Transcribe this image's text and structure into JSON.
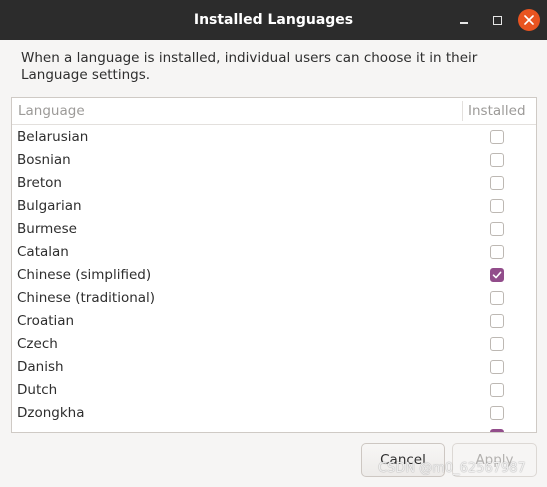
{
  "window": {
    "title": "Installed Languages"
  },
  "info_text": "When a language is installed, individual users can choose it in their Language settings.",
  "table": {
    "columns": [
      "Language",
      "Installed"
    ],
    "rows": [
      {
        "language": "Belarusian",
        "installed": false
      },
      {
        "language": "Bosnian",
        "installed": false
      },
      {
        "language": "Breton",
        "installed": false
      },
      {
        "language": "Bulgarian",
        "installed": false
      },
      {
        "language": "Burmese",
        "installed": false
      },
      {
        "language": "Catalan",
        "installed": false
      },
      {
        "language": "Chinese (simplified)",
        "installed": true
      },
      {
        "language": "Chinese (traditional)",
        "installed": false
      },
      {
        "language": "Croatian",
        "installed": false
      },
      {
        "language": "Czech",
        "installed": false
      },
      {
        "language": "Danish",
        "installed": false
      },
      {
        "language": "Dutch",
        "installed": false
      },
      {
        "language": "Dzongkha",
        "installed": false
      },
      {
        "language": "",
        "installed": true
      }
    ]
  },
  "buttons": {
    "cancel": "Cancel",
    "apply": "Apply"
  },
  "watermark": "CSDN @m0_62567987",
  "colors": {
    "titlebar": "#2c2c2c",
    "close_button": "#e95420",
    "checkbox_checked": "#924d8b"
  },
  "icons": {
    "minimize": "minimize-icon",
    "maximize": "maximize-icon",
    "close": "close-icon",
    "check": "check-icon"
  }
}
